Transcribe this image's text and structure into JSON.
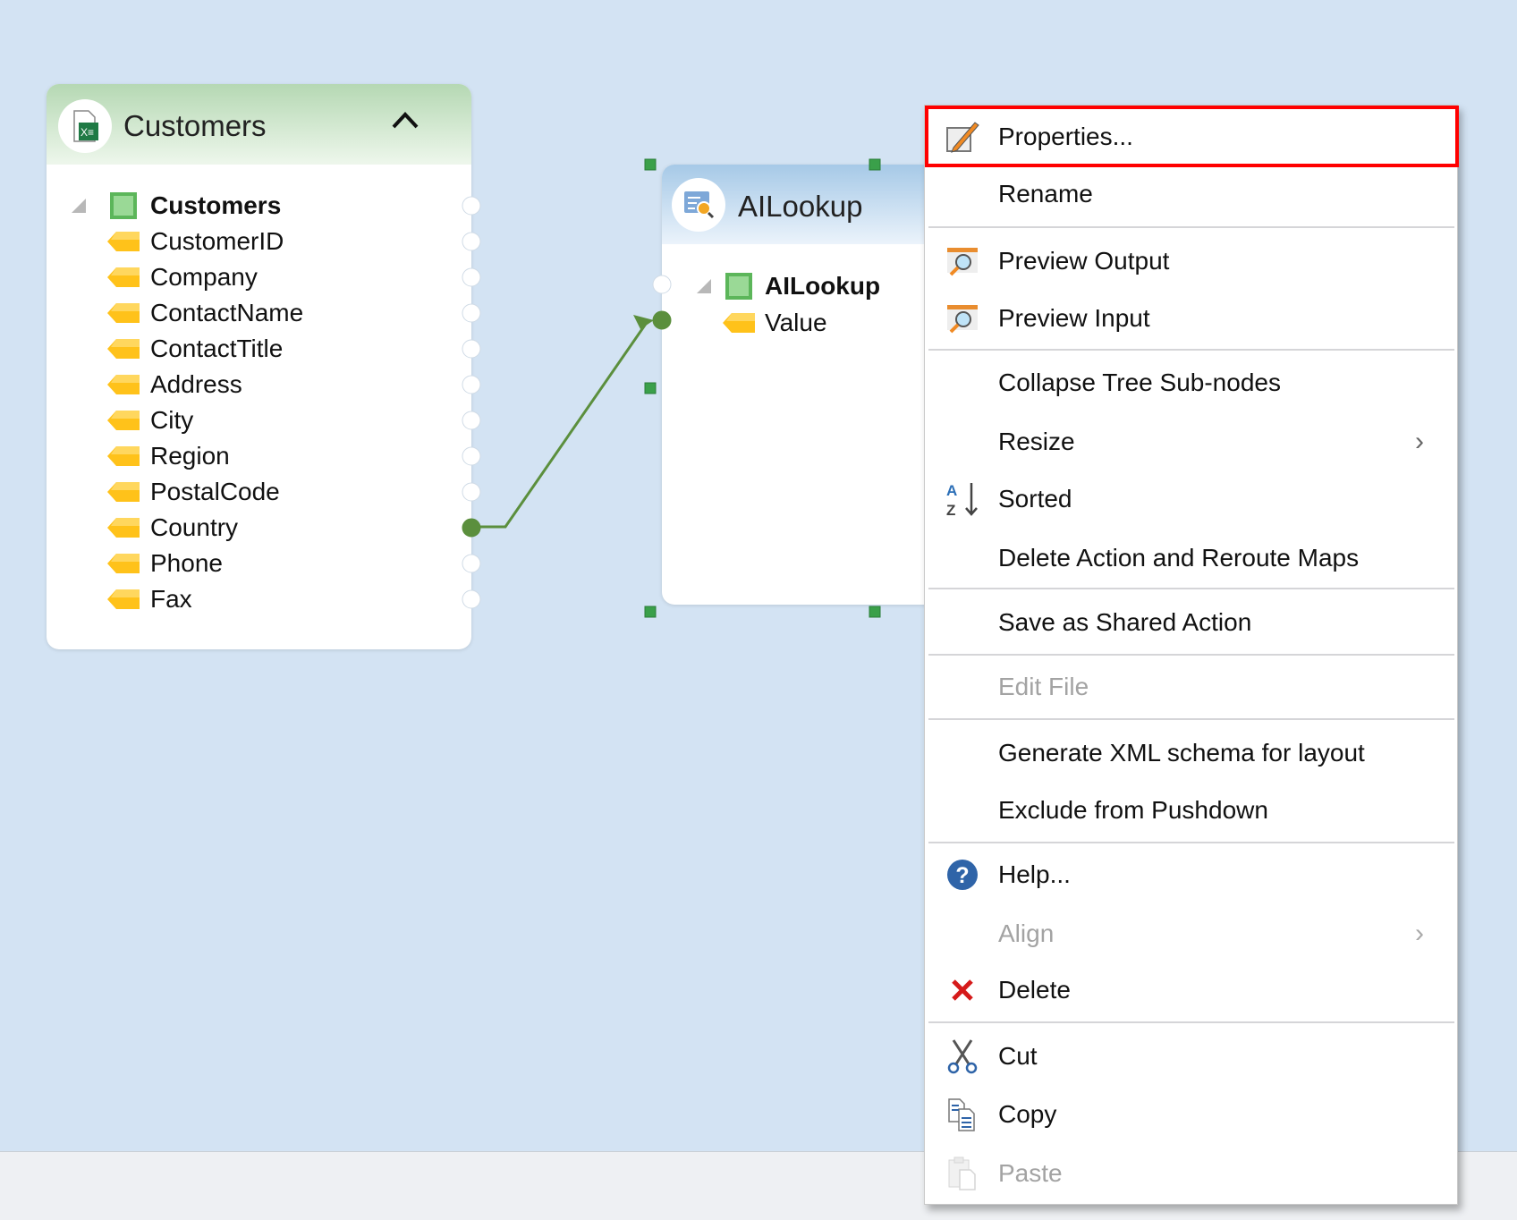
{
  "colors": {
    "canvas": "#d3e3f3",
    "accent_green": "#5b8f3d",
    "highlight": "#ff0000",
    "disabled": "#a3a3a3"
  },
  "customers_panel": {
    "title": "Customers",
    "icon": "excel-file-icon",
    "root": "Customers",
    "fields": [
      "CustomerID",
      "Company",
      "ContactName",
      "ContactTitle",
      "Address",
      "City",
      "Region",
      "PostalCode",
      "Country",
      "Phone",
      "Fax"
    ],
    "mapped_field": "Country"
  },
  "ailookup_panel": {
    "title": "AILookup",
    "icon": "ai-lookup-icon",
    "root": "AILookup",
    "fields": [
      "Value"
    ]
  },
  "context_menu": {
    "items": [
      {
        "label": "Properties...",
        "icon": "properties-icon",
        "highlighted": true
      },
      {
        "label": "Rename",
        "icon": ""
      },
      {
        "label": "Preview Output",
        "icon": "preview-icon"
      },
      {
        "label": "Preview Input",
        "icon": "preview-icon"
      },
      {
        "label": "Collapse Tree Sub-nodes",
        "icon": ""
      },
      {
        "label": "Resize",
        "icon": "",
        "submenu": true
      },
      {
        "label": "Sorted",
        "icon": "sort-az-icon"
      },
      {
        "label": "Delete Action and Reroute Maps",
        "icon": ""
      },
      {
        "label": "Save as Shared Action",
        "icon": ""
      },
      {
        "label": "Edit File",
        "icon": "",
        "disabled": true
      },
      {
        "label": "Generate XML schema for layout",
        "icon": ""
      },
      {
        "label": "Exclude from Pushdown",
        "icon": ""
      },
      {
        "label": "Help...",
        "icon": "help-icon"
      },
      {
        "label": "Align",
        "icon": "",
        "submenu": true,
        "disabled": true
      },
      {
        "label": "Delete",
        "icon": "delete-icon"
      },
      {
        "label": "Cut",
        "icon": "cut-icon"
      },
      {
        "label": "Copy",
        "icon": "copy-icon"
      },
      {
        "label": "Paste",
        "icon": "paste-icon",
        "disabled": true
      }
    ]
  }
}
